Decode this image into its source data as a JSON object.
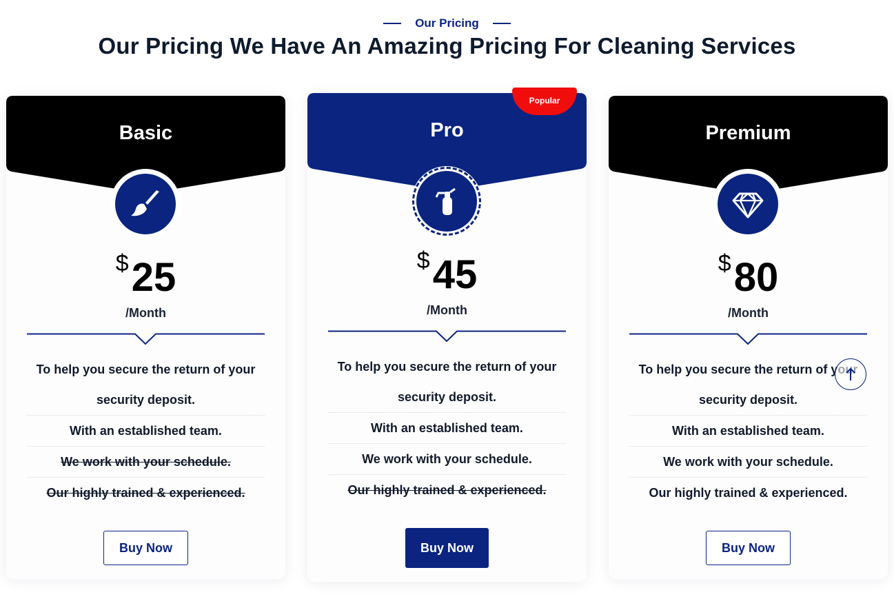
{
  "section": {
    "eyebrow": "Our Pricing",
    "headline": "Our Pricing We Have An Amazing Pricing For Cleaning Services"
  },
  "colors": {
    "accent": "#0a2480",
    "dark_header": "#000000",
    "badge": "#f20d0d",
    "text": "#0e1b2e"
  },
  "plans": [
    {
      "name": "Basic",
      "icon": "brush-icon",
      "currency": "$",
      "price": "25",
      "period": "/Month",
      "features": [
        {
          "text": "To help you secure the return of your security deposit.",
          "struck": false
        },
        {
          "text": "With an established team.",
          "struck": false
        },
        {
          "text": "We work with your schedule.",
          "struck": true
        },
        {
          "text": "Our highly trained & experienced.",
          "struck": true
        }
      ],
      "button": "Buy Now"
    },
    {
      "name": "Pro",
      "icon": "fire-extinguisher-icon",
      "badge": "Popular",
      "currency": "$",
      "price": "45",
      "period": "/Month",
      "features": [
        {
          "text": "To help you secure the return of your security deposit.",
          "struck": false
        },
        {
          "text": "With an established team.",
          "struck": false
        },
        {
          "text": "We work with your schedule.",
          "struck": false
        },
        {
          "text": "Our highly trained & experienced.",
          "struck": true
        }
      ],
      "button": "Buy Now"
    },
    {
      "name": "Premium",
      "icon": "diamond-icon",
      "currency": "$",
      "price": "80",
      "period": "/Month",
      "features": [
        {
          "text": "To help you secure the return of your security deposit.",
          "struck": false
        },
        {
          "text": "With an established team.",
          "struck": false
        },
        {
          "text": "We work with your schedule.",
          "struck": false
        },
        {
          "text": "Our highly trained & experienced.",
          "struck": false
        }
      ],
      "button": "Buy Now"
    }
  ],
  "scroll_top": {
    "icon": "arrow-up-icon"
  }
}
